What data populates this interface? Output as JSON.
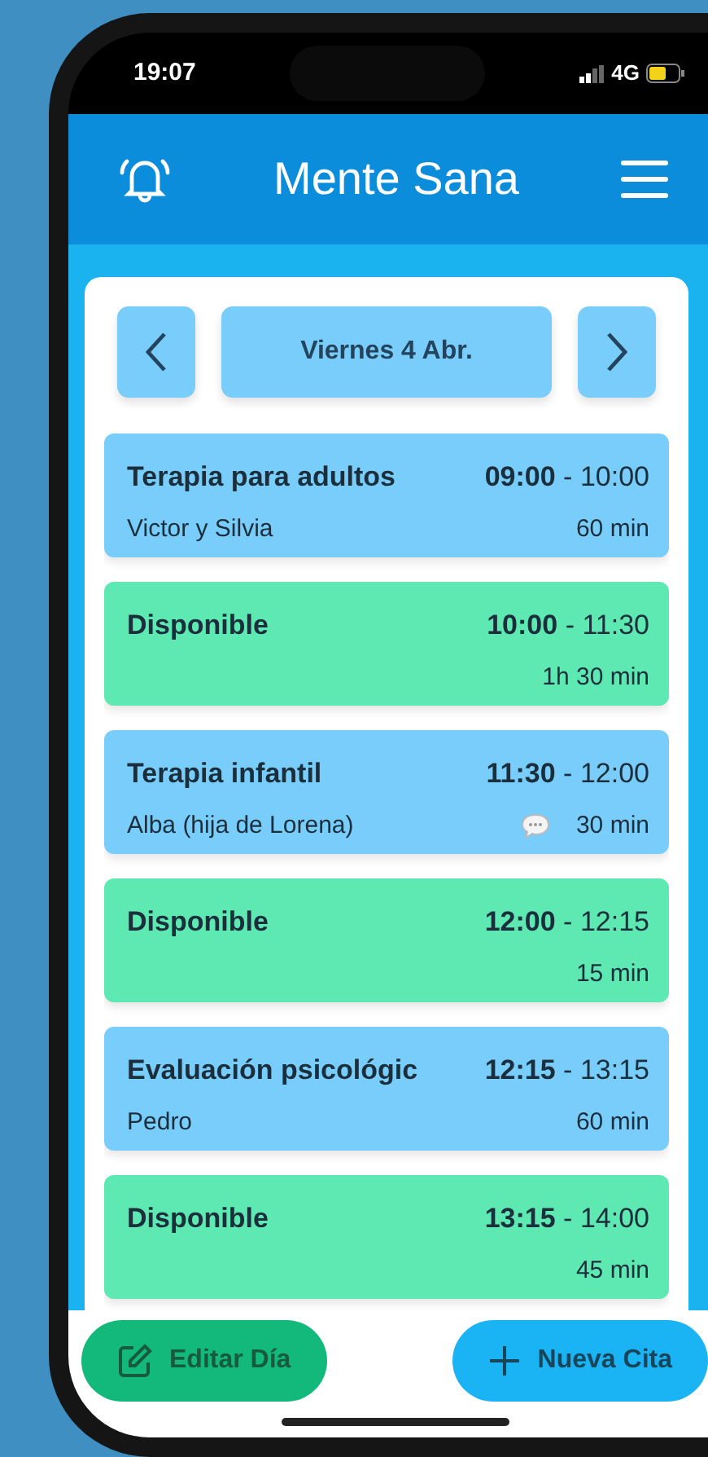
{
  "status_bar": {
    "time": "19:07",
    "network": "4G"
  },
  "header": {
    "title": "Mente Sana"
  },
  "date_nav": {
    "label": "Viernes 4 Abr."
  },
  "entries": [
    {
      "kind": "appointment",
      "title": "Terapia para adultos",
      "subtitle": "Victor y Silvia",
      "start": "09:00",
      "separator": "-",
      "end": "10:00",
      "duration": "60 min",
      "has_note": false
    },
    {
      "kind": "available",
      "title": "Disponible",
      "start": "10:00",
      "separator": "-",
      "end": "11:30",
      "duration": "1h 30 min",
      "has_note": false
    },
    {
      "kind": "appointment",
      "title": "Terapia infantil",
      "subtitle": "Alba (hija de Lorena)",
      "start": "11:30",
      "separator": "-",
      "end": "12:00",
      "duration": "30 min",
      "has_note": true
    },
    {
      "kind": "available",
      "title": "Disponible",
      "start": "12:00",
      "separator": "-",
      "end": "12:15",
      "duration": "15 min",
      "has_note": false
    },
    {
      "kind": "appointment",
      "title": "Evaluación psicológic",
      "subtitle": "Pedro",
      "start": "12:15",
      "separator": "-",
      "end": "13:15",
      "duration": "60 min",
      "has_note": false
    },
    {
      "kind": "available",
      "title": "Disponible",
      "start": "13:15",
      "separator": "-",
      "end": "14:00",
      "duration": "45 min",
      "has_note": false
    }
  ],
  "actions": [
    {
      "kind": "edit",
      "label": "Editar Día"
    },
    {
      "kind": "add",
      "label": "Nueva Cita"
    }
  ]
}
